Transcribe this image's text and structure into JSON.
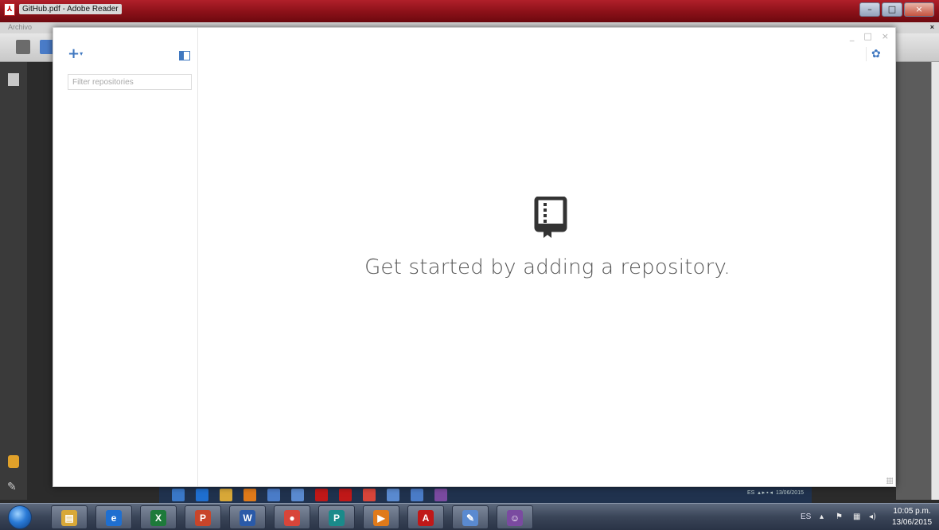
{
  "reader": {
    "window_title": "GitHub.pdf - Adobe Reader",
    "menu_first": "Archivo",
    "menu_close": "×"
  },
  "github_app": {
    "add_button": "+",
    "add_caret": "▾",
    "filter_placeholder": "Filter repositories",
    "window_min": "_",
    "window_max": "□",
    "window_close": "×",
    "settings_glyph": "✿",
    "empty_message": "Get started by adding a repository."
  },
  "pdf_strip": {
    "tray_lang": "ES",
    "tray_date": "13/06/2015"
  },
  "taskbar": {
    "apps": [
      {
        "name": "explorer",
        "glyph": "▤",
        "color": "#d8a838"
      },
      {
        "name": "internet-explorer",
        "glyph": "e",
        "color": "#1f6fd0"
      },
      {
        "name": "excel",
        "glyph": "X",
        "color": "#1d7a3a"
      },
      {
        "name": "powerpoint",
        "glyph": "P",
        "color": "#c8452a"
      },
      {
        "name": "word",
        "glyph": "W",
        "color": "#2a5aa8"
      },
      {
        "name": "chrome",
        "glyph": "●",
        "color": "#d8453a"
      },
      {
        "name": "publisher",
        "glyph": "P",
        "color": "#1a8a8a"
      },
      {
        "name": "media",
        "glyph": "▶",
        "color": "#e07a1a"
      },
      {
        "name": "acrobat",
        "glyph": "A",
        "color": "#c01818"
      },
      {
        "name": "paint",
        "glyph": "✎",
        "color": "#5a8ad0"
      },
      {
        "name": "github",
        "glyph": "☺",
        "color": "#7a4aa0"
      }
    ],
    "language": "ES",
    "tray_arrow": "▴",
    "clock_time": "10:05 p.m.",
    "clock_date": "13/06/2015"
  }
}
